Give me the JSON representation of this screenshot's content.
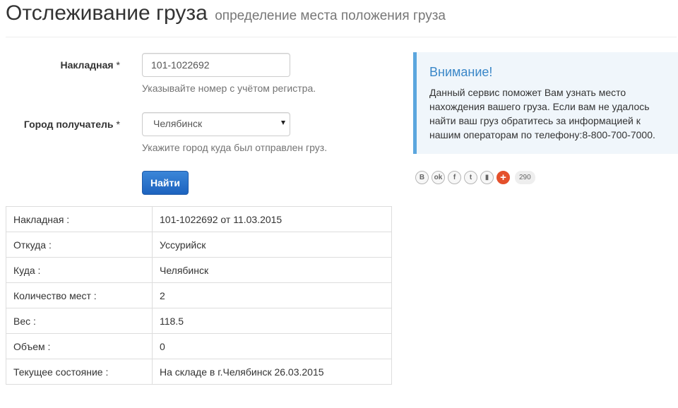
{
  "header": {
    "title": "Отслеживание груза",
    "subtitle": "определение места положения груза"
  },
  "form": {
    "invoice": {
      "label": "Накладная",
      "required_mark": "*",
      "value": "101-1022692",
      "help": "Указывайте номер с учётом регистра."
    },
    "city": {
      "label": "Город получатель",
      "required_mark": "*",
      "selected": "Челябинск",
      "help": "Укажите город куда был отправлен груз."
    },
    "submit_label": "Найти"
  },
  "results": [
    {
      "key": "Накладная :",
      "value": "101-1022692 от 11.03.2015"
    },
    {
      "key": "Откуда :",
      "value": "Уссурийск"
    },
    {
      "key": "Куда :",
      "value": "Челябинск"
    },
    {
      "key": "Количество мест :",
      "value": "2"
    },
    {
      "key": "Вес :",
      "value": "118.5"
    },
    {
      "key": "Объем :",
      "value": "0"
    },
    {
      "key": "Текущее состояние :",
      "value": "На складе в г.Челябинск 26.03.2015"
    }
  ],
  "notice": {
    "title": "Внимание!",
    "text": "Данный сервис поможет Вам узнать место нахождения вашего груза. Если вам не удалось найти ваш груз обратитесь за информацией к нашим операторам по телефону:8-800-700-7000."
  },
  "share": {
    "buttons": [
      {
        "icon": "vkontakte-icon",
        "glyph": "В"
      },
      {
        "icon": "odnoklassniki-icon",
        "glyph": "ok"
      },
      {
        "icon": "facebook-icon",
        "glyph": "f"
      },
      {
        "icon": "twitter-icon",
        "glyph": "t"
      },
      {
        "icon": "bookmark-icon",
        "glyph": "▮"
      },
      {
        "icon": "more-share-icon",
        "glyph": "+"
      }
    ],
    "count": "290"
  },
  "colors": {
    "primary_button": "#2a6fc9",
    "notice_border": "#5ba6de",
    "notice_title": "#3a87c8",
    "notice_background": "#f0f6fb"
  }
}
